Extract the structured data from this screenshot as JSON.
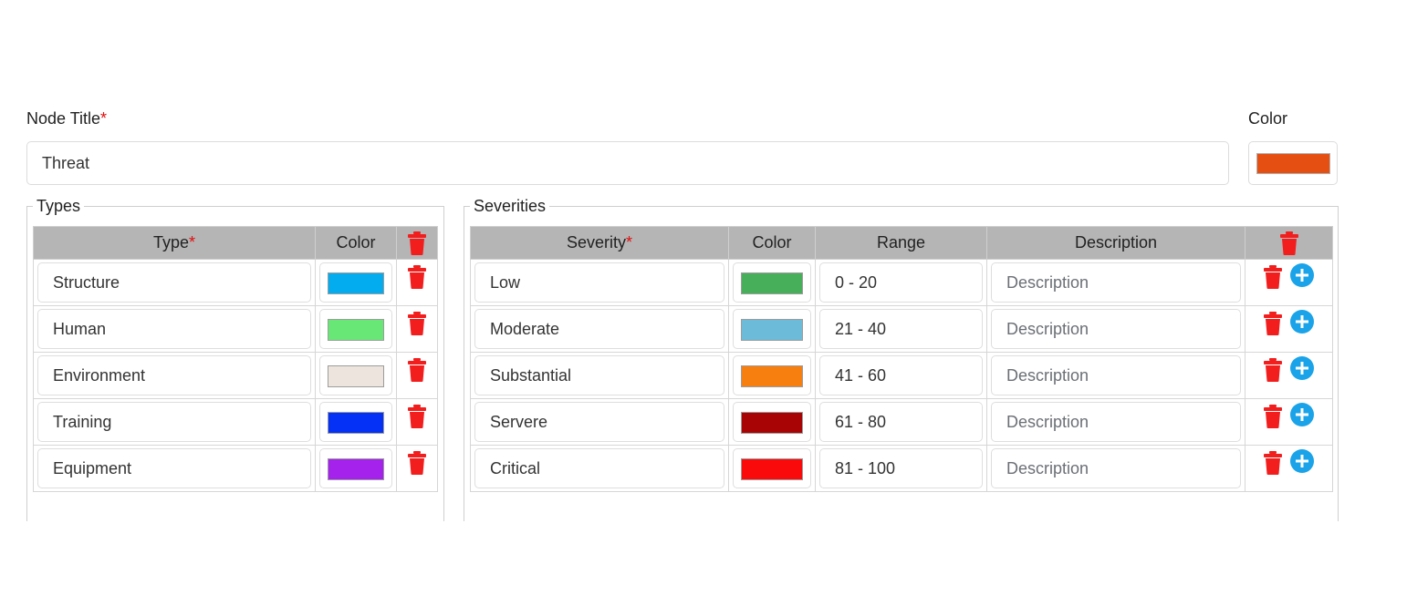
{
  "form": {
    "node_title_label": "Node Title",
    "required_mark": "*",
    "node_title_value": "Threat",
    "color_label": "Color",
    "node_color": "#e64f12"
  },
  "types": {
    "legend": "Types",
    "headers": {
      "type": "Type",
      "color": "Color"
    },
    "rows": [
      {
        "name": "Structure",
        "color": "#03acee"
      },
      {
        "name": "Human",
        "color": "#68e777"
      },
      {
        "name": "Environment",
        "color": "#ede5dd"
      },
      {
        "name": "Training",
        "color": "#0530f6"
      },
      {
        "name": "Equipment",
        "color": "#a522ed"
      }
    ]
  },
  "severities": {
    "legend": "Severities",
    "headers": {
      "severity": "Severity",
      "color": "Color",
      "range": "Range",
      "description": "Description"
    },
    "rows": [
      {
        "name": "Low",
        "color": "#47ae5a",
        "range": "0 - 20",
        "description_placeholder": "Description"
      },
      {
        "name": "Moderate",
        "color": "#6bbbd9",
        "range": "21 - 40",
        "description_placeholder": "Description"
      },
      {
        "name": "Substantial",
        "color": "#f77f10",
        "range": "41 - 60",
        "description_placeholder": "Description"
      },
      {
        "name": "Servere",
        "color": "#a90405",
        "range": "61 - 80",
        "description_placeholder": "Description"
      },
      {
        "name": "Critical",
        "color": "#fa0a0a",
        "range": "81 - 100",
        "description_placeholder": "Description"
      }
    ]
  },
  "icons": {
    "delete": "trash-icon",
    "add": "plus-circle-icon"
  },
  "accents": {
    "delete": "#f21e1e",
    "add": "#1aa3e8",
    "required": "#e01010",
    "header_bg": "#b5b5b5"
  }
}
